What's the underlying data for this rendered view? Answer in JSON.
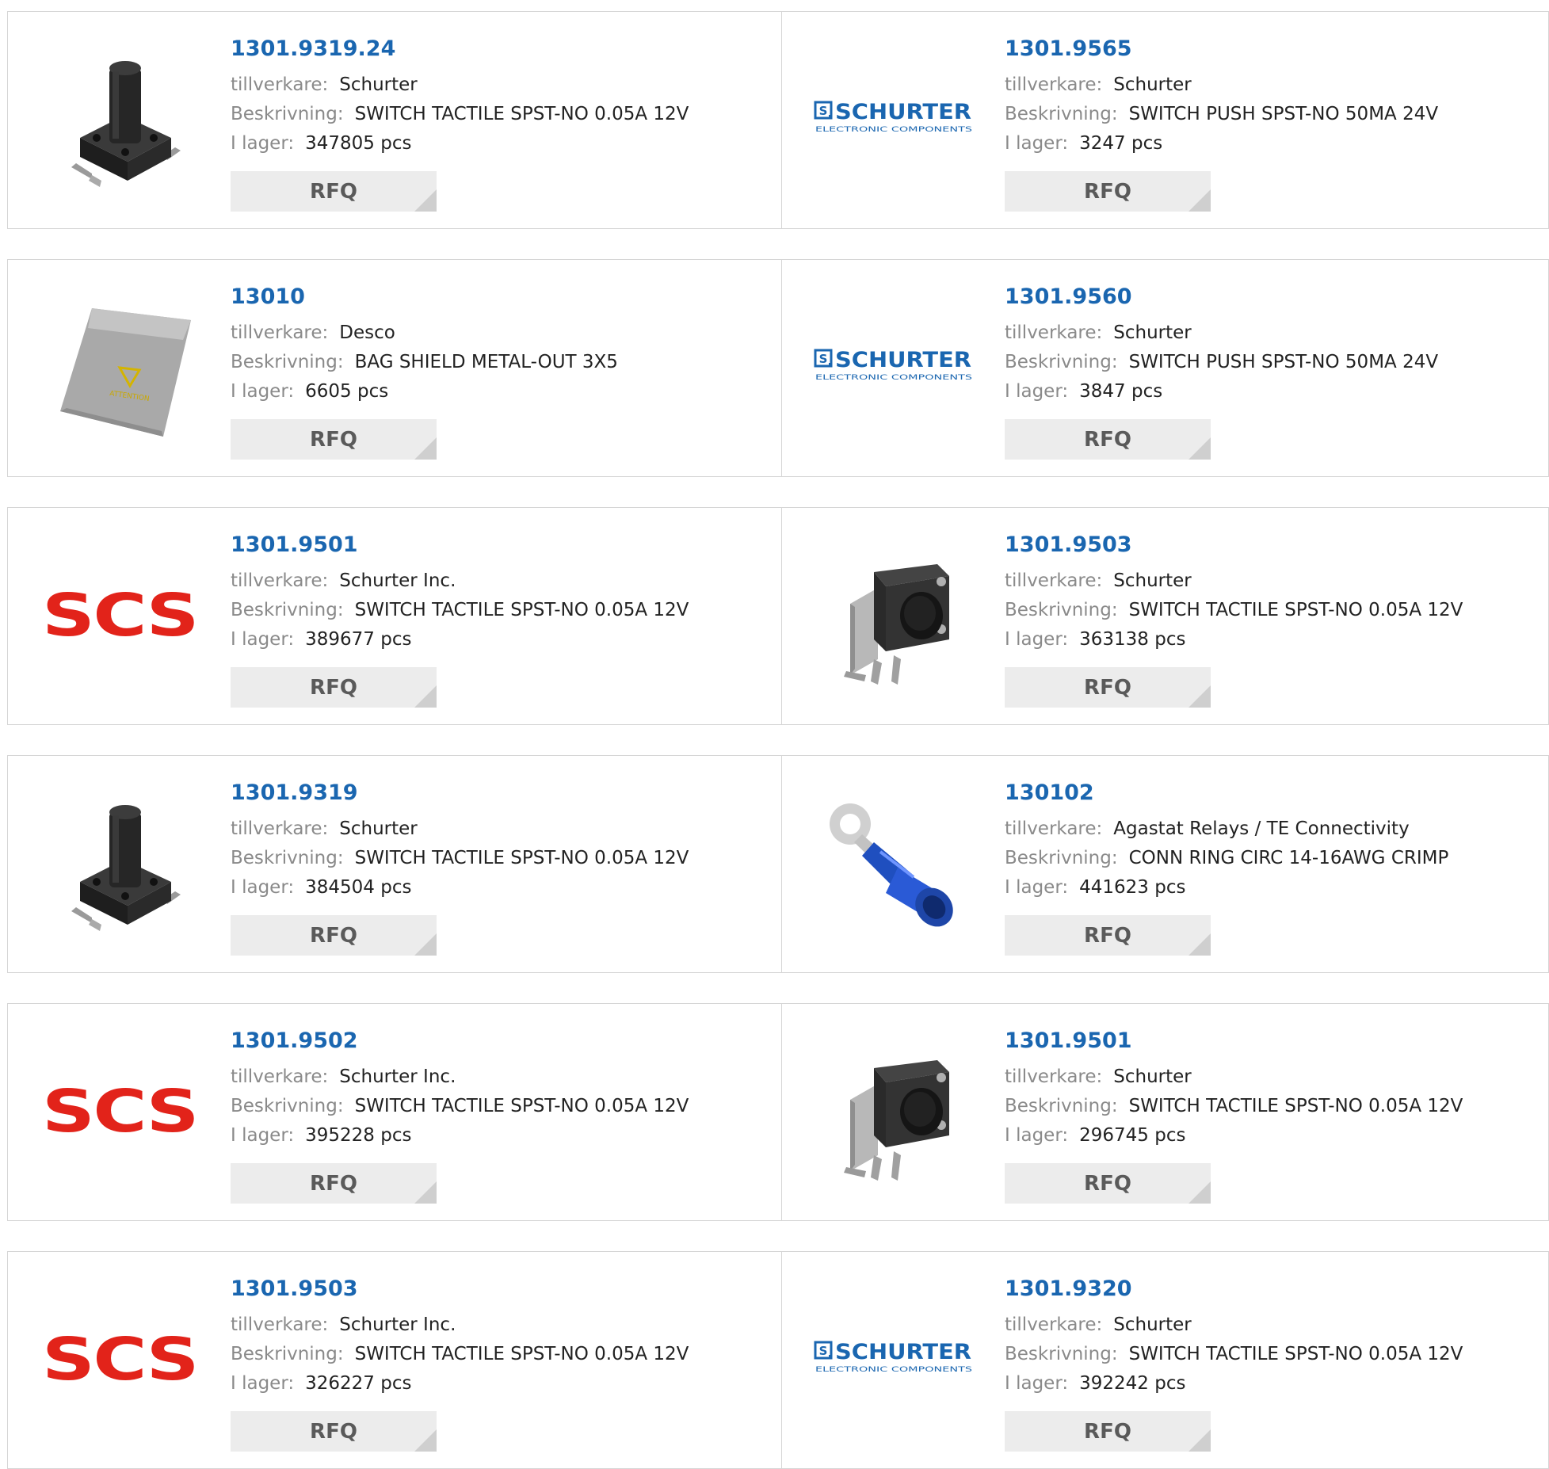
{
  "labels": {
    "manufacturer": "tillverkare:",
    "description": "Beskrivning:",
    "stock": "I lager:",
    "rfq": "RFQ"
  },
  "logos": {
    "scs": "SCS",
    "schurter_main": "SCHURTER",
    "schurter_sub": "ELECTRONIC COMPONENTS",
    "colors": {
      "scs_red": "#e2231a",
      "schurter_blue": "#1a66b0",
      "link_blue": "#1a66b0"
    }
  },
  "products": [
    {
      "part": "1301.9319.24",
      "manufacturer": "Schurter",
      "description": "SWITCH TACTILE SPST-NO 0.05A 12V",
      "stock": "347805 pcs",
      "image": "tactile-switch-tall-icon"
    },
    {
      "part": "1301.9565",
      "manufacturer": "Schurter",
      "description": "SWITCH PUSH SPST-NO 50MA 24V",
      "stock": "3247 pcs",
      "image": "schurter-logo"
    },
    {
      "part": "13010",
      "manufacturer": "Desco",
      "description": "BAG SHIELD METAL-OUT 3X5",
      "stock": "6605 pcs",
      "image": "shield-bag-icon"
    },
    {
      "part": "1301.9560",
      "manufacturer": "Schurter",
      "description": "SWITCH PUSH SPST-NO 50MA 24V",
      "stock": "3847 pcs",
      "image": "schurter-logo"
    },
    {
      "part": "1301.9501",
      "manufacturer": "Schurter Inc.",
      "description": "SWITCH TACTILE SPST-NO 0.05A 12V",
      "stock": "389677 pcs",
      "image": "scs-logo"
    },
    {
      "part": "1301.9503",
      "manufacturer": "Schurter",
      "description": "SWITCH TACTILE SPST-NO 0.05A 12V",
      "stock": "363138 pcs",
      "image": "right-angle-switch-icon"
    },
    {
      "part": "1301.9319",
      "manufacturer": "Schurter",
      "description": "SWITCH TACTILE SPST-NO 0.05A 12V",
      "stock": "384504 pcs",
      "image": "tactile-switch-tall-icon"
    },
    {
      "part": "130102",
      "manufacturer": "Agastat Relays / TE Connectivity",
      "description": "CONN RING CIRC 14-16AWG CRIMP",
      "stock": "441623 pcs",
      "image": "ring-terminal-icon"
    },
    {
      "part": "1301.9502",
      "manufacturer": "Schurter Inc.",
      "description": "SWITCH TACTILE SPST-NO 0.05A 12V",
      "stock": "395228 pcs",
      "image": "scs-logo"
    },
    {
      "part": "1301.9501",
      "manufacturer": "Schurter",
      "description": "SWITCH TACTILE SPST-NO 0.05A 12V",
      "stock": "296745 pcs",
      "image": "right-angle-switch-icon"
    },
    {
      "part": "1301.9503",
      "manufacturer": "Schurter Inc.",
      "description": "SWITCH TACTILE SPST-NO 0.05A 12V",
      "stock": "326227 pcs",
      "image": "scs-logo"
    },
    {
      "part": "1301.9320",
      "manufacturer": "Schurter",
      "description": "SWITCH TACTILE SPST-NO 0.05A 12V",
      "stock": "392242 pcs",
      "image": "schurter-logo"
    }
  ]
}
